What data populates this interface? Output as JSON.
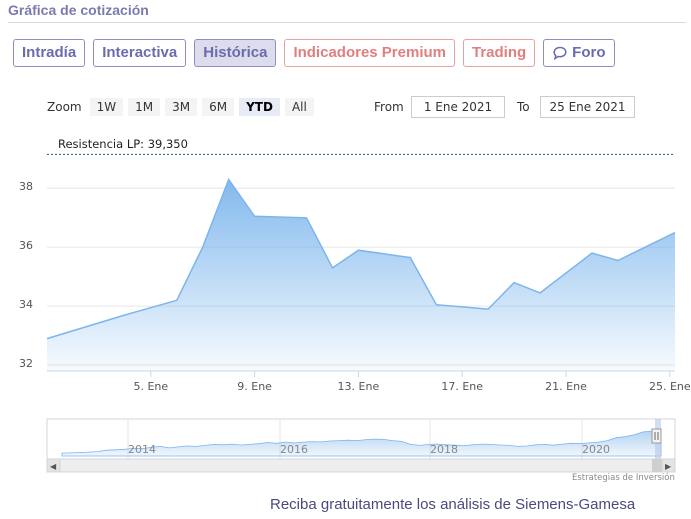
{
  "header": {
    "title": "Gráfica de cotización"
  },
  "tabs": [
    {
      "label": "Intradía",
      "style": "normal"
    },
    {
      "label": "Interactiva",
      "style": "normal"
    },
    {
      "label": "Histórica",
      "style": "active"
    },
    {
      "label": "Indicadores Premium",
      "style": "red"
    },
    {
      "label": "Trading",
      "style": "red"
    },
    {
      "label": "Foro",
      "style": "normal",
      "icon": "chat-bubble-icon"
    }
  ],
  "zoom": {
    "label": "Zoom",
    "buttons": [
      "1W",
      "1M",
      "3M",
      "6M",
      "YTD",
      "All"
    ],
    "selected": "YTD"
  },
  "range": {
    "from_label": "From",
    "from_value": "1 Ene 2021",
    "to_label": "To",
    "to_value": "25 Ene 2021"
  },
  "resistance": {
    "label": "Resistencia LP: 39,350",
    "value": 39.35
  },
  "chart_data": {
    "type": "area",
    "x": [
      1,
      4,
      6,
      7,
      8,
      9,
      10,
      11,
      12,
      13,
      14,
      15,
      16,
      17,
      18,
      19,
      20,
      21,
      22,
      23,
      24,
      25
    ],
    "x_unit": "day of January 2021",
    "values": [
      33.1,
      33.9,
      34.4,
      36.2,
      38.5,
      37.25,
      37.2,
      35.5,
      36.1,
      35.85,
      34.25,
      34.1,
      35.0,
      34.65,
      36.0,
      35.75,
      36.7
    ],
    "points": [
      {
        "x": 1,
        "y": 33.1
      },
      {
        "x": 4,
        "y": 33.9
      },
      {
        "x": 6,
        "y": 34.4
      },
      {
        "x": 7,
        "y": 36.2
      },
      {
        "x": 8,
        "y": 38.5
      },
      {
        "x": 9,
        "y": 37.25
      },
      {
        "x": 11,
        "y": 37.2
      },
      {
        "x": 12,
        "y": 35.5
      },
      {
        "x": 13,
        "y": 36.1
      },
      {
        "x": 15,
        "y": 35.85
      },
      {
        "x": 16,
        "y": 34.25
      },
      {
        "x": 18,
        "y": 34.1
      },
      {
        "x": 19,
        "y": 35.0
      },
      {
        "x": 20,
        "y": 34.65
      },
      {
        "x": 22,
        "y": 36.0
      },
      {
        "x": 23,
        "y": 35.75
      },
      {
        "x": 25.2,
        "y": 36.7
      }
    ],
    "xlim": [
      1,
      25.2
    ],
    "ylim": [
      32,
      39.5
    ],
    "y_ticks": [
      32,
      34,
      36,
      38
    ],
    "x_ticks": [
      {
        "x": 5,
        "label": "5. Ene"
      },
      {
        "x": 9,
        "label": "9. Ene"
      },
      {
        "x": 13,
        "label": "13. Ene"
      },
      {
        "x": 17,
        "label": "17. Ene"
      },
      {
        "x": 21,
        "label": "21. Ene"
      },
      {
        "x": 25,
        "label": "25. Ene"
      }
    ],
    "grid": true,
    "line_color": "#7cb5ec",
    "resistance_line_color": "#1a6b3a"
  },
  "navigator": {
    "labels": [
      "2014",
      "2016",
      "2018",
      "2020"
    ],
    "values": [
      0.15,
      0.16,
      0.18,
      0.2,
      0.23,
      0.3,
      0.32,
      0.35,
      0.4,
      0.38,
      0.45,
      0.5,
      0.42,
      0.47,
      0.52,
      0.5,
      0.55,
      0.6,
      0.58,
      0.62,
      0.57,
      0.6,
      0.64,
      0.7,
      0.66,
      0.72,
      0.68,
      0.72,
      0.75,
      0.73,
      0.78,
      0.8,
      0.82,
      0.8,
      0.85,
      0.88,
      0.86,
      0.8,
      0.76,
      0.6,
      0.55,
      0.6,
      0.62,
      0.58,
      0.56,
      0.54,
      0.58,
      0.62,
      0.6,
      0.57,
      0.55,
      0.5,
      0.52,
      0.58,
      0.6,
      0.56,
      0.62,
      0.66,
      0.64,
      0.68,
      0.72,
      0.8,
      0.95,
      1.0,
      1.1,
      1.25,
      1.3,
      1.35
    ],
    "left_arrow": "◀",
    "right_arrow": "▶"
  },
  "credit": "Estrategias de Inversión",
  "promo": "Reciba gratuitamente los análisis de Siemens-Gamesa"
}
